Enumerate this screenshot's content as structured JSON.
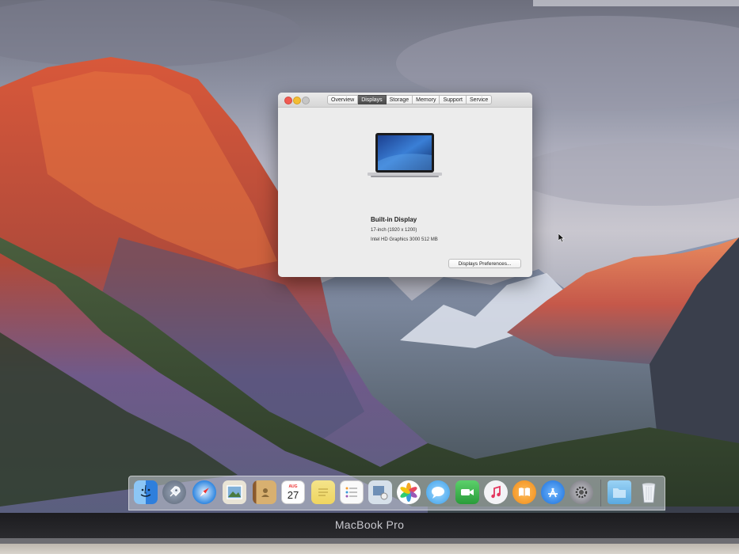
{
  "window": {
    "tabs": [
      {
        "label": "Overview"
      },
      {
        "label": "Displays"
      },
      {
        "label": "Storage"
      },
      {
        "label": "Memory"
      },
      {
        "label": "Support"
      },
      {
        "label": "Service"
      }
    ],
    "selected_tab": "Displays",
    "display_name": "Built-in Display",
    "display_resolution": "17-inch (1920 x 1200)",
    "graphics": "Intel HD Graphics 3000 512 MB",
    "prefs_button_label": "Displays Preferences..."
  },
  "dock": {
    "items": [
      {
        "name": "Finder",
        "icon": "finder-icon",
        "color": "#3d8fe8"
      },
      {
        "name": "Launchpad",
        "icon": "rocket-icon",
        "color": "#6e7b8f"
      },
      {
        "name": "Safari",
        "icon": "compass-icon",
        "color": "#2f86e0"
      },
      {
        "name": "Preview",
        "icon": "photo-icon",
        "color": "#7fb0d8"
      },
      {
        "name": "Contacts",
        "icon": "contacts-icon",
        "color": "#c99a55"
      },
      {
        "name": "Calendar",
        "icon": "calendar-icon",
        "color": "#f6f6f6",
        "month": "AUG",
        "day": "27"
      },
      {
        "name": "Notes",
        "icon": "notes-icon",
        "color": "#f3e07a"
      },
      {
        "name": "Reminders",
        "icon": "list-icon",
        "color": "#f7f7f7"
      },
      {
        "name": "Photo Booth",
        "icon": "photobooth-icon",
        "color": "#c9d6e4"
      },
      {
        "name": "Photos",
        "icon": "flower-icon",
        "color": "#ffffff"
      },
      {
        "name": "Messages",
        "icon": "chat-icon",
        "color": "#5bb8f0"
      },
      {
        "name": "FaceTime",
        "icon": "video-icon",
        "color": "#3cbf4b"
      },
      {
        "name": "iTunes",
        "icon": "music-icon",
        "color": "#f1f1f4"
      },
      {
        "name": "iBooks",
        "icon": "book-icon",
        "color": "#f59a2c"
      },
      {
        "name": "App Store",
        "icon": "appstore-icon",
        "color": "#2d86e6"
      },
      {
        "name": "System Preferences",
        "icon": "gear-icon",
        "color": "#8a8a90"
      },
      {
        "name": "Downloads",
        "icon": "folder-icon",
        "color": "#6bb4e6"
      },
      {
        "name": "Trash",
        "icon": "trash-icon",
        "color": "#dfe3e8"
      }
    ]
  },
  "bezel": {
    "brand": "MacBook Pro"
  }
}
